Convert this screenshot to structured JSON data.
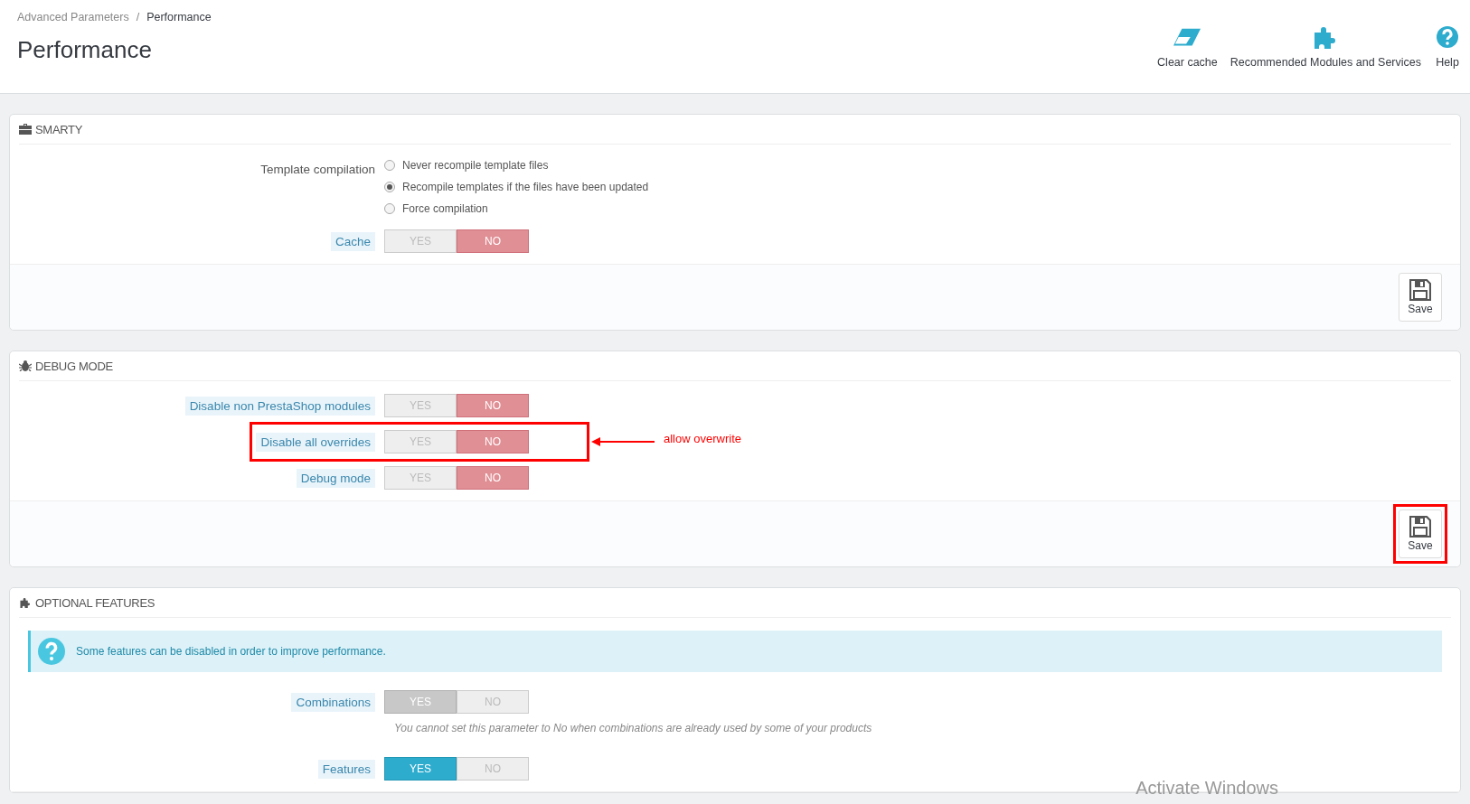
{
  "breadcrumb": {
    "items": [
      "Advanced Parameters",
      "Performance"
    ],
    "separator": "/"
  },
  "page_title": "Performance",
  "toolbar": [
    {
      "label": "Clear cache"
    },
    {
      "label": "Recommended Modules and Services"
    },
    {
      "label": "Help"
    }
  ],
  "panels": [
    {
      "title": "SMARTY",
      "rows": [
        {
          "kind": "radio",
          "label": "Template compilation",
          "options": [
            {
              "label": "Never recompile template files",
              "selected": false
            },
            {
              "label": "Recompile templates if the files have been updated",
              "selected": true
            },
            {
              "label": "Force compilation",
              "selected": false
            }
          ]
        },
        {
          "kind": "toggle",
          "label": "Cache",
          "disabled": false,
          "highlighted": false,
          "options": [
            {
              "label": "YES",
              "selected": false
            },
            {
              "label": "NO",
              "selected": true
            }
          ]
        }
      ],
      "save": {
        "label": "Save",
        "highlighted": false
      }
    },
    {
      "title": "DEBUG MODE",
      "rows": [
        {
          "kind": "toggle",
          "label": "Disable non PrestaShop modules",
          "disabled": false,
          "highlighted": false,
          "options": [
            {
              "label": "YES",
              "selected": false
            },
            {
              "label": "NO",
              "selected": true
            }
          ]
        },
        {
          "kind": "toggle",
          "label": "Disable all overrides",
          "disabled": false,
          "highlighted": true,
          "note": "allow overwrite",
          "options": [
            {
              "label": "YES",
              "selected": false
            },
            {
              "label": "NO",
              "selected": true
            }
          ]
        },
        {
          "kind": "toggle",
          "label": "Debug mode",
          "disabled": false,
          "highlighted": false,
          "options": [
            {
              "label": "YES",
              "selected": false
            },
            {
              "label": "NO",
              "selected": true
            }
          ]
        }
      ],
      "save": {
        "label": "Save",
        "highlighted": true
      }
    },
    {
      "title": "OPTIONAL FEATURES",
      "alert": "Some features can be disabled in order to improve performance.",
      "rows": [
        {
          "kind": "toggle",
          "label": "Combinations",
          "disabled": true,
          "highlighted": false,
          "hint": "You cannot set this parameter to No when combinations are already used by some of your products",
          "options": [
            {
              "label": "YES",
              "selected": true
            },
            {
              "label": "NO",
              "selected": false
            }
          ]
        },
        {
          "kind": "toggle",
          "label": "Features",
          "disabled": false,
          "highlighted": false,
          "options": [
            {
              "label": "YES",
              "selected": true
            },
            {
              "label": "NO",
              "selected": false
            }
          ]
        }
      ]
    }
  ],
  "os_notice": "Activate Windows"
}
